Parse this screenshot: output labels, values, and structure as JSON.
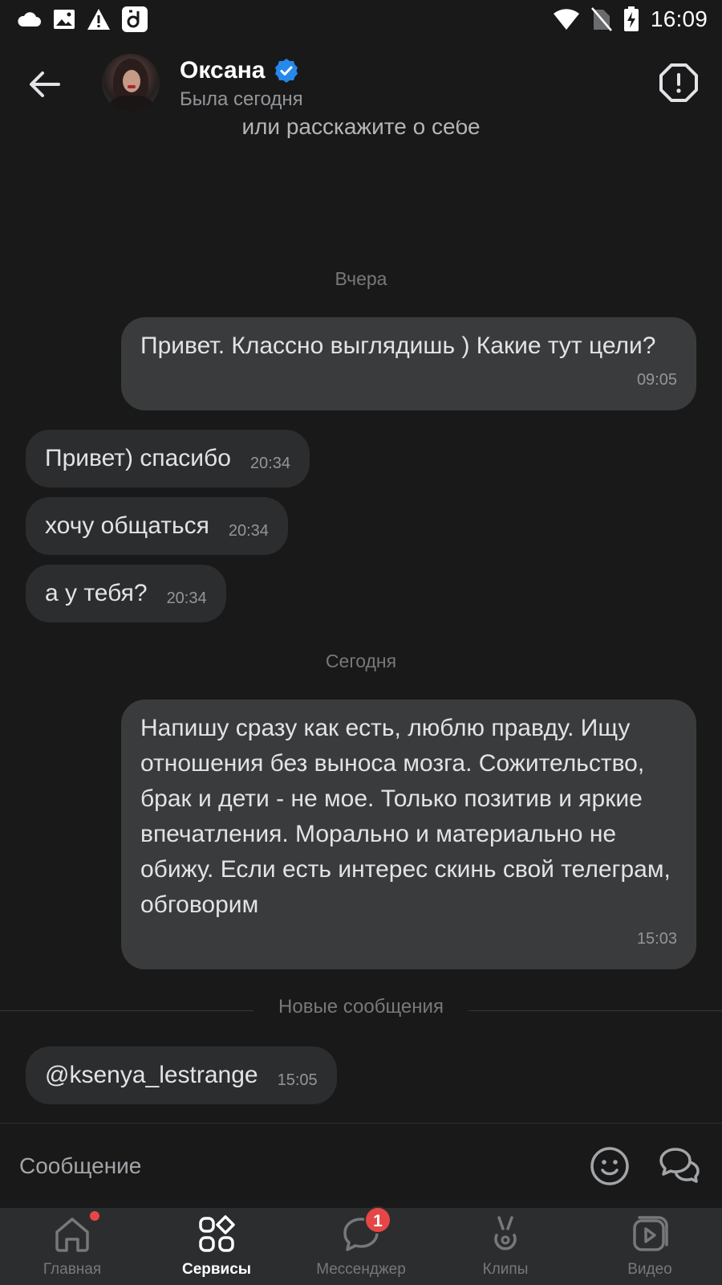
{
  "status_bar": {
    "time": "16:09",
    "left_icons": [
      "cloud-icon",
      "image-icon",
      "warning-icon",
      "app-notification-icon"
    ],
    "right_icons": [
      "wifi-icon",
      "no-sim-icon",
      "battery-charging-icon"
    ]
  },
  "header": {
    "contact_name": "Оксана",
    "contact_status": "Была сегодня",
    "verified": true,
    "accent_color": "#2688eb"
  },
  "partial_text": "или расскажите о себе",
  "chat": {
    "date_yesterday": "Вчера",
    "date_today": "Сегодня",
    "new_messages_label": "Новые сообщения",
    "messages": [
      {
        "direction": "out",
        "text": "Привет. Классно выглядишь ) Какие тут цели?",
        "time": "09:05"
      },
      {
        "direction": "in",
        "text": "Привет) спасибо",
        "time": "20:34"
      },
      {
        "direction": "in",
        "text": "хочу общаться",
        "time": "20:34"
      },
      {
        "direction": "in",
        "text": "а у тебя?",
        "time": "20:34"
      },
      {
        "direction": "out",
        "text": "Напишу сразу как есть, люблю правду. Ищу отношения без выноса мозга. Сожительство, брак и дети - не мое. Только позитив и яркие впечатления. Морально и материально не обижу. Если есть интерес скинь свой телеграм, обговорим",
        "time": "15:03"
      },
      {
        "direction": "in",
        "text": "@ksenya_lestrange",
        "time": "15:05"
      }
    ]
  },
  "composer": {
    "placeholder": "Сообщение"
  },
  "tabbar": {
    "tabs": [
      {
        "label": "Главная",
        "icon": "home-icon",
        "dot_badge": true
      },
      {
        "label": "Сервисы",
        "icon": "services-icon",
        "active": true
      },
      {
        "label": "Мессенджер",
        "icon": "messenger-icon",
        "badge": "1"
      },
      {
        "label": "Клипы",
        "icon": "clips-icon"
      },
      {
        "label": "Видео",
        "icon": "video-icon"
      }
    ]
  }
}
